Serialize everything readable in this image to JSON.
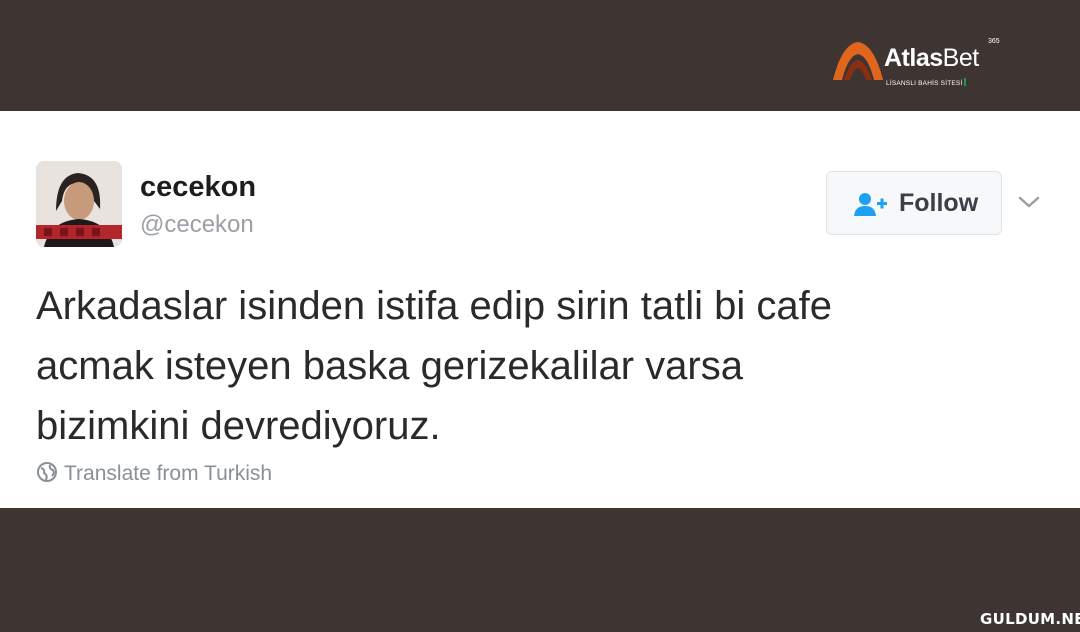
{
  "brand": {
    "name_bold": "Atlas",
    "name_light": "Bet",
    "superscript": "365",
    "tagline": "LİSANSLI BAHİS SİTESİ",
    "icon": "atlasbet-arch-logo",
    "accent_color": "#e0661d"
  },
  "tweet": {
    "display_name": "cecekon",
    "handle": "@cecekon",
    "follow_label": "Follow",
    "follow_icon": "add-user-icon",
    "more_icon": "chevron-down-icon",
    "text_lines": [
      "Arkadaslar isinden istifa edip sirin tatli bi cafe",
      "acmak isteyen baska gerizekalilar varsa",
      "bizimkini devrediyoruz."
    ],
    "translate_label": "Translate from Turkish",
    "translate_icon": "globe-icon",
    "accent_color": "#1da1f2"
  },
  "watermark": "GULDUM.NET"
}
